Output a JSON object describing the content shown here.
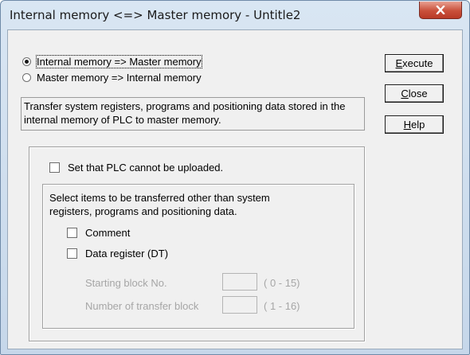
{
  "window": {
    "title": "Internal memory <=> Master memory - Untitle2",
    "close_icon": "close-x-icon"
  },
  "direction": {
    "options": [
      {
        "label": "Internal memory => Master memory",
        "selected": true
      },
      {
        "label": "Master memory => Internal memory",
        "selected": false
      }
    ]
  },
  "description": "Transfer system registers, programs and positioning data stored in the internal memory of PLC to master memory.",
  "buttons": {
    "execute_prefix": "",
    "execute_key": "E",
    "execute_rest": "xecute",
    "close_key": "C",
    "close_rest": "lose",
    "help_key": "H",
    "help_rest": "elp"
  },
  "options": {
    "no_upload_label": "Set that PLC cannot be uploaded.",
    "no_upload_checked": false,
    "items_intro": "Select items to be transferred other than system registers, programs and positioning data.",
    "comment_label": "Comment",
    "comment_checked": false,
    "data_register_label": "Data register (DT)",
    "data_register_checked": false,
    "starting_block_label": "Starting block No.",
    "starting_block_value": "",
    "starting_block_range": "( 0 - 15)",
    "transfer_block_label": "Number of transfer block",
    "transfer_block_value": "",
    "transfer_block_range": "( 1 - 16)"
  },
  "colors": {
    "frame": "#c6d7ea",
    "close_button": "#c9503a",
    "dialog_face": "#f0f0f0",
    "disabled_text": "#a6a6a6"
  }
}
